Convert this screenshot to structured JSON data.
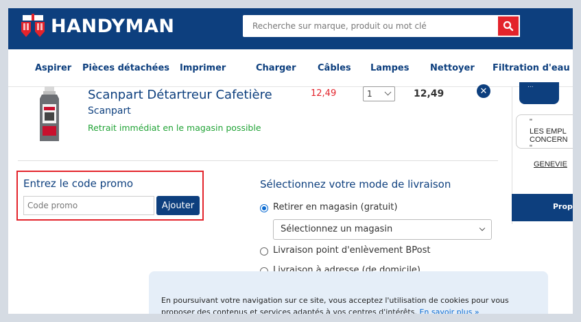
{
  "header": {
    "logo_text": "HANDYMAN",
    "search_placeholder": "Recherche sur marque, produit ou mot clé",
    "brand_color": "#0d3f7e",
    "accent_color": "#e3232b"
  },
  "nav": {
    "items": [
      "Aspirer",
      "Pièces détachées",
      "Imprimer",
      "Charger",
      "Câbles",
      "Lampes",
      "Nettoyer",
      "Filtration d'eau"
    ]
  },
  "cart_item": {
    "title": "Scanpart Détartreur Cafetière",
    "brand": "Scanpart",
    "availability": "Retrait immédiat en le magasin possible",
    "unit_price": "12,49",
    "quantity": "1",
    "total": "12,49",
    "remove_label": "✕"
  },
  "sidebar": {
    "top_button": "...",
    "quote_mark_open": "\"",
    "quote_line_1": "LES EMPL",
    "quote_line_2": "CONCERN",
    "quote_mark_close": "\"",
    "author": "GENEVIE",
    "footer_button": "Prop"
  },
  "promo": {
    "title": "Entrez le code promo",
    "input_placeholder": "Code promo",
    "button_label": "Ajouter"
  },
  "delivery": {
    "title": "Sélectionnez votre mode de livraison",
    "options": [
      {
        "label": "Retirer en magasin (gratuit)",
        "checked": true
      },
      {
        "label": "Livraison point d'enlèvement BPost",
        "checked": false
      },
      {
        "label": "Livraison à adresse (de domicile)",
        "checked": false
      }
    ],
    "store_select_value": "Sélectionnez un magasin"
  },
  "cookie_banner": {
    "text": "En poursuivant votre navigation sur ce site, vous acceptez l'utilisation de cookies pour vous proposer des contenus et services adaptés à vos centres d'intérêts.",
    "link_text": "En savoir plus »"
  }
}
